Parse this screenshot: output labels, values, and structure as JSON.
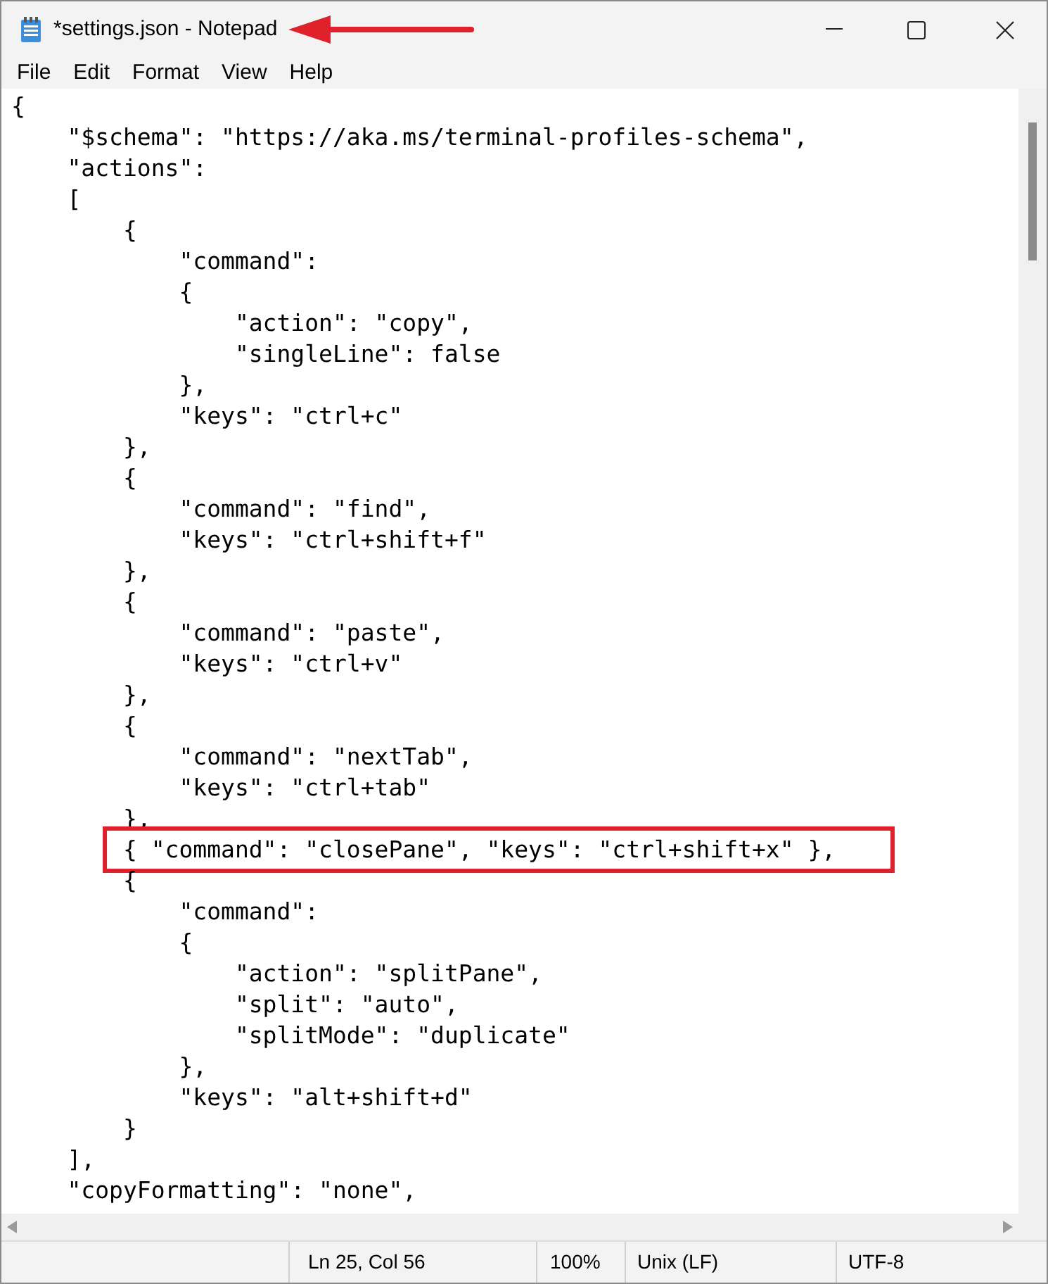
{
  "window": {
    "title": "*settings.json - Notepad"
  },
  "menu": [
    {
      "label": "File"
    },
    {
      "label": "Edit"
    },
    {
      "label": "Format"
    },
    {
      "label": "View"
    },
    {
      "label": "Help"
    }
  ],
  "lines": [
    {
      "text": "{",
      "highlighted": false
    },
    {
      "text": "    \"$schema\": \"https://aka.ms/terminal-profiles-schema\",",
      "highlighted": false
    },
    {
      "text": "    \"actions\":",
      "highlighted": false
    },
    {
      "text": "    [",
      "highlighted": false
    },
    {
      "text": "        {",
      "highlighted": false
    },
    {
      "text": "            \"command\":",
      "highlighted": false
    },
    {
      "text": "            {",
      "highlighted": false
    },
    {
      "text": "                \"action\": \"copy\",",
      "highlighted": false
    },
    {
      "text": "                \"singleLine\": false",
      "highlighted": false
    },
    {
      "text": "            },",
      "highlighted": false
    },
    {
      "text": "            \"keys\": \"ctrl+c\"",
      "highlighted": false
    },
    {
      "text": "        },",
      "highlighted": false
    },
    {
      "text": "        {",
      "highlighted": false
    },
    {
      "text": "            \"command\": \"find\",",
      "highlighted": false
    },
    {
      "text": "            \"keys\": \"ctrl+shift+f\"",
      "highlighted": false
    },
    {
      "text": "        },",
      "highlighted": false
    },
    {
      "text": "        {",
      "highlighted": false
    },
    {
      "text": "            \"command\": \"paste\",",
      "highlighted": false
    },
    {
      "text": "            \"keys\": \"ctrl+v\"",
      "highlighted": false
    },
    {
      "text": "        },",
      "highlighted": false
    },
    {
      "text": "        {",
      "highlighted": false
    },
    {
      "text": "            \"command\": \"nextTab\",",
      "highlighted": false
    },
    {
      "text": "            \"keys\": \"ctrl+tab\"",
      "highlighted": false
    },
    {
      "text": "        },",
      "highlighted": false
    },
    {
      "text": "        { \"command\": \"closePane\", \"keys\": \"ctrl+shift+x\" },",
      "highlighted": true
    },
    {
      "text": "        {",
      "highlighted": false
    },
    {
      "text": "            \"command\":",
      "highlighted": false
    },
    {
      "text": "            {",
      "highlighted": false
    },
    {
      "text": "                \"action\": \"splitPane\",",
      "highlighted": false
    },
    {
      "text": "                \"split\": \"auto\",",
      "highlighted": false
    },
    {
      "text": "                \"splitMode\": \"duplicate\"",
      "highlighted": false
    },
    {
      "text": "            },",
      "highlighted": false
    },
    {
      "text": "            \"keys\": \"alt+shift+d\"",
      "highlighted": false
    },
    {
      "text": "        }",
      "highlighted": false
    },
    {
      "text": "    ],",
      "highlighted": false
    },
    {
      "text": "    \"copyFormatting\": \"none\",",
      "highlighted": false
    }
  ],
  "status_bar": {
    "position": "Ln 25, Col 56",
    "zoom": "100%",
    "line_ending": "Unix (LF)",
    "encoding": "UTF-8"
  }
}
